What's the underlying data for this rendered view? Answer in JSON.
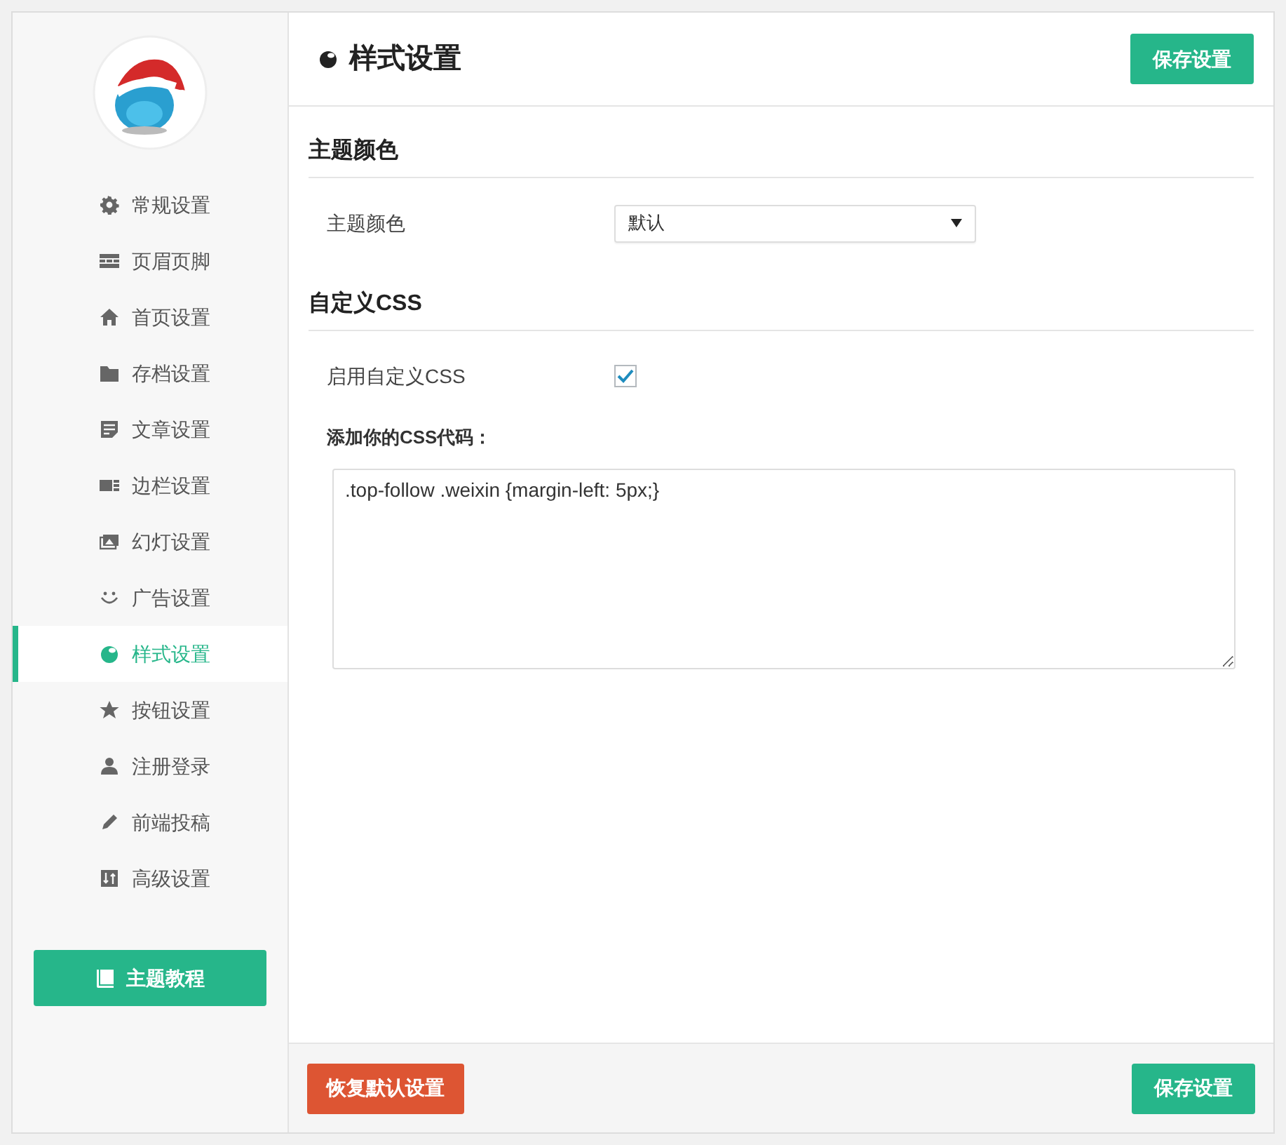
{
  "sidebar": {
    "items": [
      {
        "label": "常规设置",
        "selected": false
      },
      {
        "label": "页眉页脚",
        "selected": false
      },
      {
        "label": "首页设置",
        "selected": false
      },
      {
        "label": "存档设置",
        "selected": false
      },
      {
        "label": "文章设置",
        "selected": false
      },
      {
        "label": "边栏设置",
        "selected": false
      },
      {
        "label": "幻灯设置",
        "selected": false
      },
      {
        "label": "广告设置",
        "selected": false
      },
      {
        "label": "样式设置",
        "selected": true
      },
      {
        "label": "按钮设置",
        "selected": false
      },
      {
        "label": "注册登录",
        "selected": false
      },
      {
        "label": "前端投稿",
        "selected": false
      },
      {
        "label": "高级设置",
        "selected": false
      }
    ],
    "tutorial_button": "主题教程"
  },
  "header": {
    "title": "样式设置",
    "save_button": "保存设置"
  },
  "sections": [
    {
      "title": "主题颜色",
      "fields": [
        {
          "kind": "select",
          "label": "主题颜色",
          "value": "默认"
        }
      ]
    },
    {
      "title": "自定义CSS",
      "fields": [
        {
          "kind": "checkbox",
          "label": "启用自定义CSS",
          "checked": true
        },
        {
          "kind": "textarea",
          "label": "添加你的CSS代码：",
          "value": ".top-follow .weixin {margin-left: 5px;}"
        }
      ]
    }
  ],
  "footer": {
    "reset_button": "恢复默认设置",
    "save_button": "保存设置"
  }
}
